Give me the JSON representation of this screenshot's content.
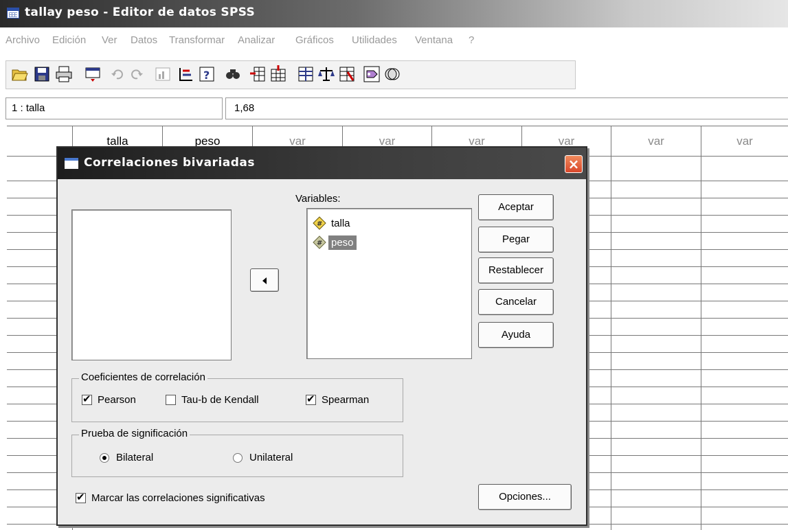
{
  "window": {
    "title": "tallay peso - Editor de datos SPSS"
  },
  "menu": [
    "Archivo",
    "Edición",
    "Ver",
    "Datos",
    "Transformar",
    "Analizar",
    "Gráficos",
    "Utilidades",
    "Ventana",
    "?"
  ],
  "toolbar": {
    "icons": [
      "open-icon",
      "save-icon",
      "print-icon",
      "dialog-recall-icon",
      "undo-icon",
      "redo-icon",
      "goto-chart-icon",
      "goto-case-icon",
      "variables-icon",
      "find-icon",
      "insert-case-icon",
      "insert-variable-icon",
      "split-file-icon",
      "weight-cases-icon",
      "select-cases-icon",
      "value-labels-icon",
      "use-sets-icon"
    ]
  },
  "cell_editor": {
    "reference": "1 : talla",
    "value": "1,68"
  },
  "grid": {
    "columns": [
      "talla",
      "peso",
      "var",
      "var",
      "var",
      "var",
      "var",
      "var"
    ]
  },
  "dialog": {
    "title": "Correlaciones bivariadas",
    "close_label": "×",
    "variables_label": "Variables:",
    "source_variables": [],
    "selected_variables": [
      {
        "name": "talla",
        "selected": false
      },
      {
        "name": "peso",
        "selected": true
      }
    ],
    "buttons": {
      "ok": "Aceptar",
      "paste": "Pegar",
      "reset": "Restablecer",
      "cancel": "Cancelar",
      "help": "Ayuda",
      "options": "Opciones..."
    },
    "coefficients": {
      "title": "Coeficientes de correlación",
      "pearson": {
        "label": "Pearson",
        "checked": true
      },
      "kendall": {
        "label": "Tau-b de Kendall",
        "checked": false
      },
      "spearman": {
        "label": "Spearman",
        "checked": true
      }
    },
    "significance": {
      "title": "Prueba de significación",
      "two_tailed": {
        "label": "Bilateral",
        "selected": true
      },
      "one_tailed": {
        "label": "Unilateral",
        "selected": false
      }
    },
    "flag_significant": {
      "label": "Marcar las correlaciones significativas",
      "checked": true
    }
  }
}
